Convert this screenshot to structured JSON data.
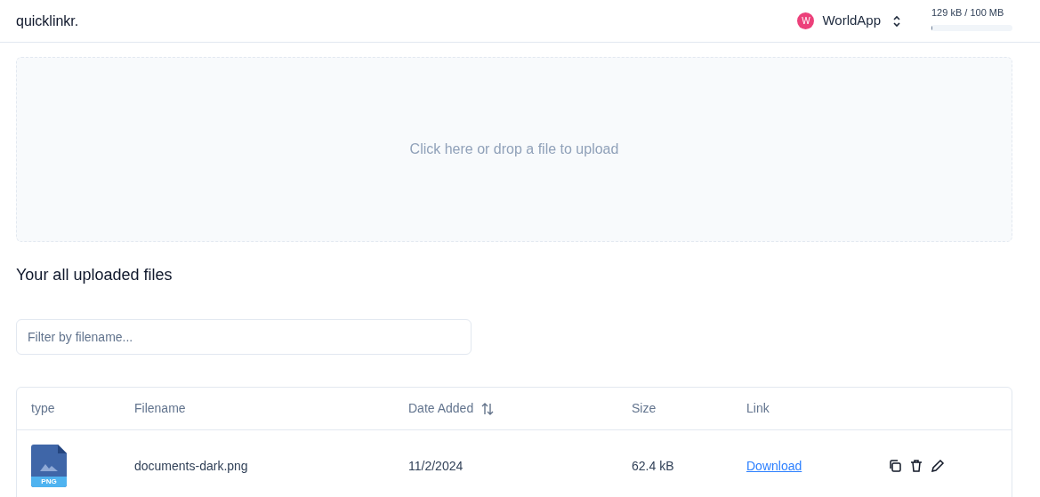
{
  "header": {
    "logo": "quicklinkr.",
    "workspace": {
      "initial": "W",
      "name": "WorldApp",
      "color": "#ec407a"
    },
    "storage": {
      "reading": "129 kB / 100 MB",
      "level": 0.0013
    }
  },
  "dropzone": {
    "text": "Click here or drop a file to upload"
  },
  "section_title": "Your all uploaded files",
  "filter": {
    "placeholder": "Filter by filename..."
  },
  "table": {
    "columns": [
      {
        "label": "type",
        "sortable": false
      },
      {
        "label": "Filename",
        "sortable": false
      },
      {
        "label": "Date Added",
        "sortable": true
      },
      {
        "label": "Size",
        "sortable": false
      },
      {
        "label": "Link",
        "sortable": false
      }
    ],
    "rows": [
      {
        "type_label": "PNG",
        "filename": "documents-dark.png",
        "date": "11/2/2024",
        "size": "62.4 kB",
        "link": "Download"
      }
    ]
  }
}
